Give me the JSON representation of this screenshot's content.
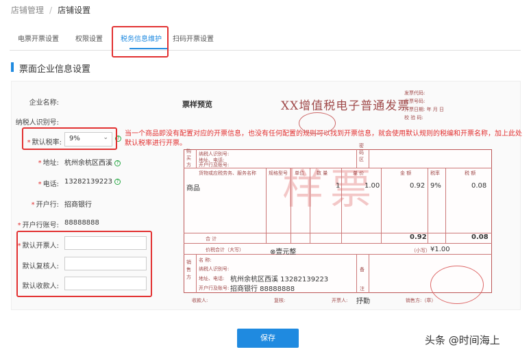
{
  "breadcrumb": {
    "parent": "店铺管理",
    "separator": "/",
    "current": "店铺设置"
  },
  "tabs": [
    "电票开票设置",
    "权限设置",
    "税务信息维护",
    "扫码开票设置"
  ],
  "section_title": "票面企业信息设置",
  "form": {
    "company_name_label": "企业名称:",
    "taxpayer_id_label": "纳税人识别号:",
    "default_tax_rate_label": "默认税率:",
    "default_tax_rate_value": "9%",
    "address_label": "地址:",
    "address_value": "杭州余杭区西溪",
    "phone_label": "电话:",
    "phone_value": "13282139223",
    "bank_label": "开户行:",
    "bank_value": "招商银行",
    "account_label": "开户行账号:",
    "account_value": "88888888",
    "drawer_label": "默认开票人:",
    "reviewer_label": "默认复核人:",
    "payee_label": "默认收款人:"
  },
  "note": "当一个商品即没有配置对应的开票信息，也没有任何配置的规则可以找到开票信息，就会使用默认规则的税编和开票名称，加上此处默认税率进行开票。",
  "preview": {
    "title": "票样预览",
    "invoice_title": "XX增值税电子普通发票",
    "meta_code": "发票代码:",
    "meta_no": "发票号码:",
    "meta_date": "开票日期:    年   月   日",
    "meta_check": "校 验 码:",
    "buyer_label": "购买方",
    "password_label": "密码区",
    "buyer_taxid": "纳税人识别号:",
    "buyer_addr": "地址、电话:",
    "buyer_bank": "开户行及账号:",
    "col_goods": "货物或应税劳务、服务名称",
    "col_spec": "规格型号",
    "col_unit": "单位",
    "col_qty": "数 量",
    "col_price": "单 价",
    "col_amount": "金 额",
    "col_rate": "税率",
    "col_tax": "税 额",
    "item_name": "商品",
    "item_qty": "1",
    "item_price": "1.00",
    "item_amount": "0.92",
    "item_rate": "9%",
    "item_tax": "0.08",
    "total_label": "合    计",
    "total_amount": "0.92",
    "total_tax": "0.08",
    "grand_label": "价税合计（大写）",
    "grand_words": "⊗壹元整",
    "grand_small_label": "（小写）",
    "grand_small": "¥1.00",
    "seller_label": "销售方",
    "seller_name_label": "名    称:",
    "seller_taxid": "纳税人识别号:",
    "seller_addr_label": "地址、电话:",
    "seller_addr": "杭州余杭区西溪 13282139223",
    "seller_bank_label": "开户行及账号:",
    "seller_bank": "招商银行 88888888",
    "remark_label": "备注",
    "payee": "收款人:",
    "reviewer": "复核:",
    "drawer": "开票人:",
    "drawer_name": "抒勤",
    "seller_sign": "销售方:（章）",
    "watermark": "样票"
  },
  "save_label": "保存",
  "footer_watermark": "头条 @时间海上",
  "colors": {
    "accent": "#1f8ae0",
    "highlight": "#e23030",
    "invoice": "#a04a4a"
  }
}
